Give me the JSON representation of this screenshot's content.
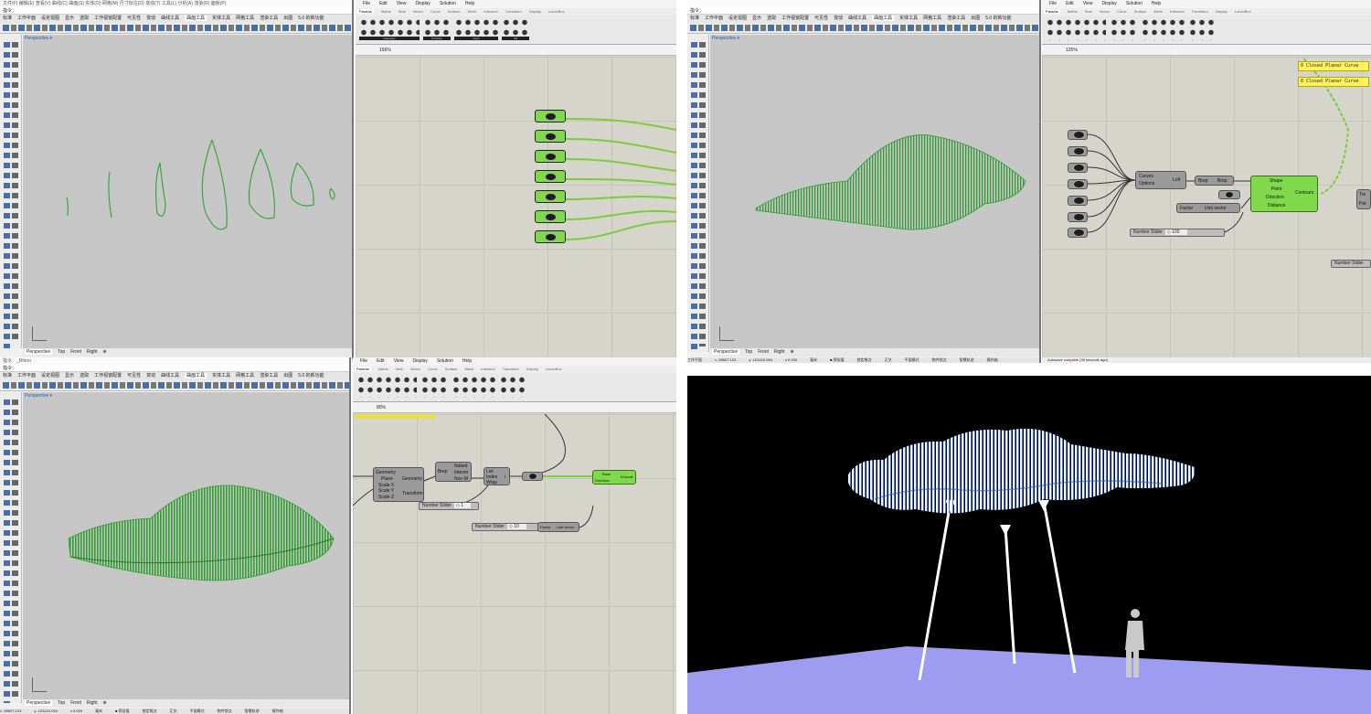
{
  "q1": {
    "rhino": {
      "menu": "文件(F)  编辑(E)  查看(V)  曲线(C)  曲面(S)  实体(O)  网格(M)  尺寸标注(D)  变动(T)  工具(L)  分析(A)  渲染(R)  面板(P)",
      "command_label": "指令：",
      "tabs": [
        "标准",
        "工作平面",
        "设定视图",
        "显示",
        "选取",
        "工作视窗配置",
        "可见性",
        "变动",
        "曲线工具",
        "曲面工具",
        "实体工具",
        "网格工具",
        "渲染工具",
        "出图",
        "5.0 的新功能"
      ],
      "viewport_label": "Perspective ▾",
      "view_tabs": [
        "Perspective",
        "Top",
        "Front",
        "Right",
        "⊕"
      ]
    },
    "gh": {
      "menu": [
        "File",
        "Edit",
        "View",
        "Display",
        "Solution",
        "Help"
      ],
      "tabs": [
        "Params",
        "Maths",
        "Sets",
        "Vector",
        "Curve",
        "Surface",
        "Mesh",
        "Intersect",
        "Transform",
        "Display",
        "LunchBox"
      ],
      "ribbon_groups": [
        "Geometry",
        "Primitive",
        "Input",
        "Util"
      ],
      "zoom": "156%"
    }
  },
  "q2": {
    "rhino": {
      "command_label": "指令：",
      "tabs": [
        "标准",
        "工作平面",
        "设定视图",
        "显示",
        "选取",
        "工作视窗配置",
        "可见性",
        "变动",
        "曲线工具",
        "曲面工具",
        "实体工具",
        "网格工具",
        "渲染工具",
        "出图",
        "5.0 的新功能"
      ],
      "viewport_label": "Perspective ▾",
      "view_tabs": [
        "Perspective",
        "Top",
        "Front",
        "Right",
        "⊕"
      ],
      "status": [
        "工作平面",
        "x -59607.103",
        "y -103410.054",
        "z 0.000",
        "毫米",
        "■ 预设值",
        "锁定格点",
        "正交",
        "平面模式",
        "物件锁点",
        "智慧轨迹",
        "操作轴"
      ]
    },
    "gh": {
      "menu": [
        "File",
        "Edit",
        "View",
        "Display",
        "Solution",
        "Help"
      ],
      "tabs": [
        "Params",
        "Maths",
        "Sets",
        "Vector",
        "Curve",
        "Surface",
        "Mesh",
        "Intersect",
        "Transform",
        "Display",
        "LunchBox"
      ],
      "zoom": "125%",
      "panel_text": [
        "0 Closed Planar Curve",
        "0 Closed Planar Curve"
      ],
      "loft_inputs": [
        "Curves",
        "Options"
      ],
      "loft_label": "Loft",
      "brep_in": "Brep",
      "brep_out": "Brep",
      "contour_inputs": [
        "Shape",
        "Point",
        "Direction",
        "Distance"
      ],
      "contour_label": "Contours",
      "unit_inputs": [
        "Factor"
      ],
      "unit_label": "Unit vector",
      "slider_label": "Number Slider",
      "slider_value": "◇ 100",
      "slider2_label": "Number Slider",
      "right_ports": [
        "Tre",
        "Pat"
      ],
      "status": "Autosave complete (39 seconds ago)"
    }
  },
  "q3": {
    "rhino": {
      "title": "指令：_Rhino",
      "command_label": "指令：",
      "tabs": [
        "标准",
        "工作平面",
        "设定视图",
        "显示",
        "选取",
        "工作视窗配置",
        "可见性",
        "变动",
        "曲线工具",
        "曲面工具",
        "实体工具",
        "网格工具",
        "渲染工具",
        "出图",
        "5.0 的新功能"
      ],
      "viewport_label": "Perspective ▾",
      "view_tabs": [
        "Perspective",
        "Top",
        "Front",
        "Right",
        "⊕"
      ],
      "status": [
        "x -59607.103",
        "y -103410.054",
        "z 0.000",
        "毫米",
        "■ 预设值",
        "锁定格点",
        "正交",
        "平面模式",
        "物件锁点",
        "智慧轨迹",
        "操作轴"
      ]
    },
    "gh": {
      "menu": [
        "File",
        "Edit",
        "View",
        "Display",
        "Solution",
        "Help"
      ],
      "tabs": [
        "Params",
        "Maths",
        "Sets",
        "Vector",
        "Curve",
        "Surface",
        "Mesh",
        "Intersect",
        "Transform",
        "Display",
        "LunchBox"
      ],
      "zoom": "80%",
      "scale_inputs": [
        "Geometry",
        "Plane",
        "Scale X",
        "Scale Y",
        "Scale Z"
      ],
      "scale_outputs": [
        "Geometry",
        "Transform"
      ],
      "edges_in": "Brep",
      "edges_outputs": [
        "Naked",
        "Interior",
        "Non-M"
      ],
      "list_inputs": [
        "List",
        "Index",
        "Wrap"
      ],
      "list_output": "i",
      "extrude_inputs": [
        "Base",
        "Direction"
      ],
      "extrude_label": "Extrude",
      "unit_inputs": [
        "Factor"
      ],
      "unit_label": "Unit vector",
      "slider_a_label": "Number Slider",
      "slider_a_value": "◇ 1",
      "slider_b_label": "Number Slider",
      "slider_b_value": "◇ 10"
    }
  }
}
